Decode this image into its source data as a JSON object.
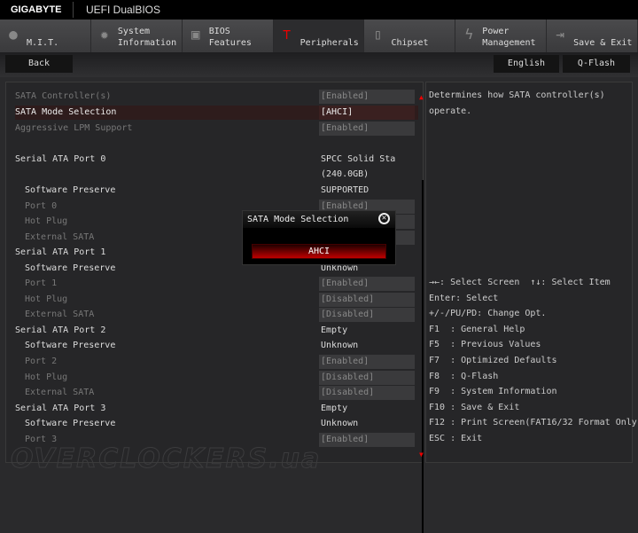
{
  "header": {
    "brand": "GIGABYTE",
    "product": "UEFI DualBIOS"
  },
  "tabs": [
    {
      "label": "M.I.T.",
      "icon": "disc-icon"
    },
    {
      "label": "System\nInformation",
      "icon": "gear-icon"
    },
    {
      "label": "BIOS\nFeatures",
      "icon": "chip-icon"
    },
    {
      "label": "Peripherals",
      "icon": "plug-icon",
      "active": true
    },
    {
      "label": "Chipset",
      "icon": "board-icon"
    },
    {
      "label": "Power\nManagement",
      "icon": "power-icon"
    },
    {
      "label": "Save & Exit",
      "icon": "exit-icon"
    }
  ],
  "toolbar": {
    "back": "Back",
    "language": "English",
    "qflash": "Q-Flash"
  },
  "settings": [
    {
      "label": "SATA Controller(s)",
      "value": "[Enabled]",
      "dim": true,
      "box": true
    },
    {
      "label": "SATA Mode Selection",
      "value": "[AHCI]",
      "selected": true
    },
    {
      "label": "Aggressive LPM Support",
      "value": "[Enabled]",
      "dim": true,
      "box": true
    },
    {
      "label": "Serial ATA Port 0",
      "value": "SPCC Solid Sta"
    },
    {
      "label": "",
      "value": "(240.0GB)"
    },
    {
      "label": "Software Preserve",
      "value": "SUPPORTED",
      "sub": true
    },
    {
      "label": "Port 0",
      "value": "[Enabled]",
      "sub": true,
      "dim": true,
      "box": true
    },
    {
      "label": "Hot Plug",
      "value": "",
      "sub": true,
      "dim": true,
      "box": true
    },
    {
      "label": "External SATA",
      "value": "",
      "sub": true,
      "dim": true,
      "box": true
    },
    {
      "label": "Serial ATA Port 1",
      "value": ""
    },
    {
      "label": "Software Preserve",
      "value": "Unknown",
      "sub": true
    },
    {
      "label": "Port 1",
      "value": "[Enabled]",
      "sub": true,
      "dim": true,
      "box": true
    },
    {
      "label": "Hot Plug",
      "value": "[Disabled]",
      "sub": true,
      "dim": true,
      "box": true
    },
    {
      "label": "External SATA",
      "value": "[Disabled]",
      "sub": true,
      "dim": true,
      "box": true
    },
    {
      "label": "Serial ATA Port 2",
      "value": "Empty"
    },
    {
      "label": "Software Preserve",
      "value": "Unknown",
      "sub": true
    },
    {
      "label": "Port 2",
      "value": "[Enabled]",
      "sub": true,
      "dim": true,
      "box": true
    },
    {
      "label": "Hot Plug",
      "value": "[Disabled]",
      "sub": true,
      "dim": true,
      "box": true
    },
    {
      "label": "External SATA",
      "value": "[Disabled]",
      "sub": true,
      "dim": true,
      "box": true
    },
    {
      "label": "Serial ATA Port 3",
      "value": "Empty"
    },
    {
      "label": "Software Preserve",
      "value": "Unknown",
      "sub": true
    },
    {
      "label": "Port 3",
      "value": "[Enabled]",
      "sub": true,
      "dim": true,
      "box": true
    }
  ],
  "help": {
    "description": [
      "Determines how SATA controller(s)",
      "operate."
    ],
    "keys": [
      "→←: Select Screen  ↑↓: Select Item",
      "Enter: Select",
      "+/-/PU/PD: Change Opt.",
      "F1  : General Help",
      "F5  : Previous Values",
      "F7  : Optimized Defaults",
      "F8  : Q-Flash",
      "F9  : System Information",
      "F10 : Save & Exit",
      "F12 : Print Screen(FAT16/32 Format Only)",
      "ESC : Exit"
    ]
  },
  "modal": {
    "title": "SATA Mode Selection",
    "option": "AHCI"
  },
  "watermark": "OVERCLOCKERS.ua",
  "colors": {
    "accent": "#e00000"
  }
}
